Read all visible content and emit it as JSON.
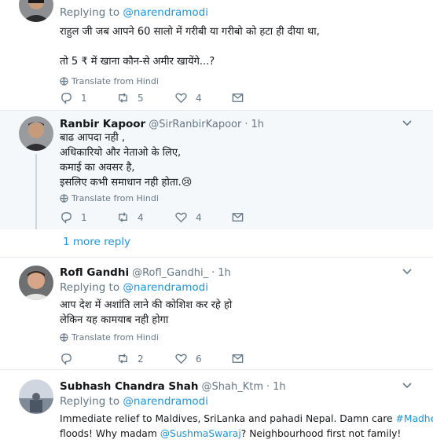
{
  "tweets": [
    {
      "replying_prefix": "Replying to ",
      "replying_handle": "@narendramodi",
      "lines": [
        "राहुल जी जब आपने 60 सालो में गरीबी या गरीबो को हटा ही दीया था,",
        "",
        "तो 5 ₹ में खाना कौन-से अमीर खायेंगे...?"
      ],
      "translate": "Translate from Hindi",
      "reply_count": "1",
      "retweet_count": "5",
      "like_count": "4"
    },
    {
      "name": "Ranbir Kapoor",
      "handle": "@SirRanbirKapoor",
      "dot": "·",
      "time": "1h",
      "lines": [
        "बाढ आपदा नही ,",
        "अधिकारियो और नेताओ के लिए,",
        "कमाई का अवसर है,",
        "इसलिए कभी समाधान नही होता."
      ],
      "emoji": "😢",
      "translate": "Translate from Hindi",
      "reply_count": "1",
      "retweet_count": "4",
      "like_count": "4"
    },
    {
      "name": "Rofl Gandhi",
      "handle": "@Rofl_Gandhi_",
      "dot": "·",
      "time": "1h",
      "replying_prefix": "Replying to ",
      "replying_handle": "@narendramodi",
      "lines": [
        "आप देश में अशांति लाने की कोशिश कर रहे हो",
        "लेकिन यह कामयाब नही होगा"
      ],
      "translate": "Translate from Hindi",
      "reply_count": "",
      "retweet_count": "2",
      "like_count": "6"
    },
    {
      "name": "Subhash Chandra Shah",
      "handle": "@Shah_Ktm",
      "dot": "·",
      "time": "1h",
      "replying_prefix": "Replying to ",
      "replying_handle": "@narendramodi",
      "line1": "Immediate relief to Maldives, SriLanka and pahadi Nepal. Damn care ",
      "hashtag": "#Madhesh",
      "line2a": "floods! Why madam ",
      "mention": "@SushmaSwaraj",
      "line2b": "? Neighbourhood first not family!"
    }
  ],
  "more_reply": "1 more reply",
  "colors": {
    "link": "#1b95e0",
    "muted": "#657786",
    "text": "#14171a",
    "highlight": "#f5f8fa",
    "divider": "#e6ecf0"
  },
  "icons": [
    "reply-icon",
    "retweet-icon",
    "like-icon",
    "message-icon",
    "globe-icon",
    "chevron-down-icon"
  ]
}
